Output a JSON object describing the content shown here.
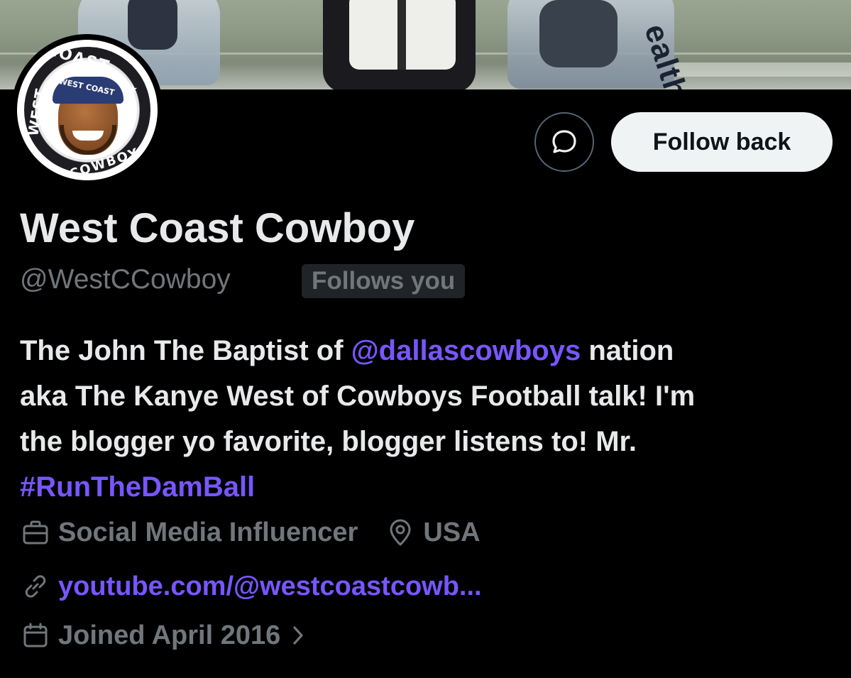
{
  "banner": {
    "text": "ealth"
  },
  "avatar": {
    "top_text": "COAST",
    "left_text": "WEST",
    "bottom_text": "COWBOY",
    "cap_text": "WEST COAST"
  },
  "actions": {
    "follow_label": "Follow back",
    "message_icon": "message-bubble-icon"
  },
  "profile": {
    "display_name": "West Coast Cowboy",
    "handle": "@WestCCowboy",
    "follows_you": "Follows you",
    "bio": {
      "line1_pre": "The John The Baptist of ",
      "line1_mention": "@dallascowboys",
      "line1_post": " nation",
      "line2": "aka The Kanye West of Cowboys Football talk! I'm",
      "line3": "the blogger yo favorite, blogger listens to! Mr.",
      "hashtag": "#RunTheDamBall"
    },
    "category": "Social Media Influencer",
    "location": "USA",
    "website": "youtube.com/@westcoastcowb...",
    "joined": "Joined April 2016"
  },
  "colors": {
    "background": "#000000",
    "primary_text": "#e7e9ea",
    "secondary_text": "#71767b",
    "link": "#7856ff",
    "button_bg": "#eff3f4"
  },
  "icons": [
    "briefcase-icon",
    "location-pin-icon",
    "link-icon",
    "calendar-icon",
    "chevron-right-icon",
    "message-bubble-icon"
  ]
}
